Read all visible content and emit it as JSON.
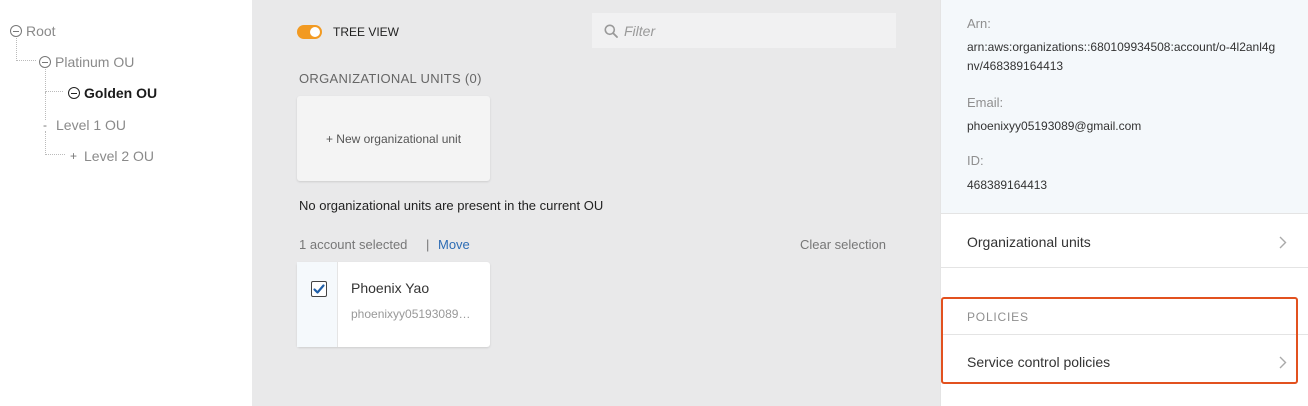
{
  "tree": {
    "root": "Root",
    "platinum": "Platinum OU",
    "golden": "Golden OU",
    "level1": "Level 1 OU",
    "level2": "Level 2 OU"
  },
  "toolbar": {
    "tree_view_label": "TREE VIEW",
    "tree_view_on": true,
    "filter_placeholder": "Filter"
  },
  "ou_section": {
    "title": "ORGANIZATIONAL UNITS (0)",
    "new_button": "+ New organizational unit",
    "empty_message": "No organizational units are present in the current OU"
  },
  "selection": {
    "count_text": "1 account selected",
    "separator": "|",
    "move_label": "Move",
    "clear_label": "Clear selection"
  },
  "account_card": {
    "name": "Phoenix Yao",
    "email": "phoenixyy05193089@gmail.com",
    "checked": true
  },
  "details": {
    "arn_label": "Arn:",
    "arn_value": "arn:aws:organizations::680109934508:account/o-4l2anl4gnv/468389164413",
    "email_label": "Email:",
    "email_value": "phoenixyy05193089@gmail.com",
    "id_label": "ID:",
    "id_value": "468389164413"
  },
  "nav": {
    "org_units": "Organizational units",
    "policies_title": "POLICIES",
    "service_control": "Service control policies"
  },
  "colors": {
    "accent": "#f29a22",
    "link": "#2e6db4",
    "highlight": "#e2511f",
    "checkbox": "#1f5fa8"
  }
}
